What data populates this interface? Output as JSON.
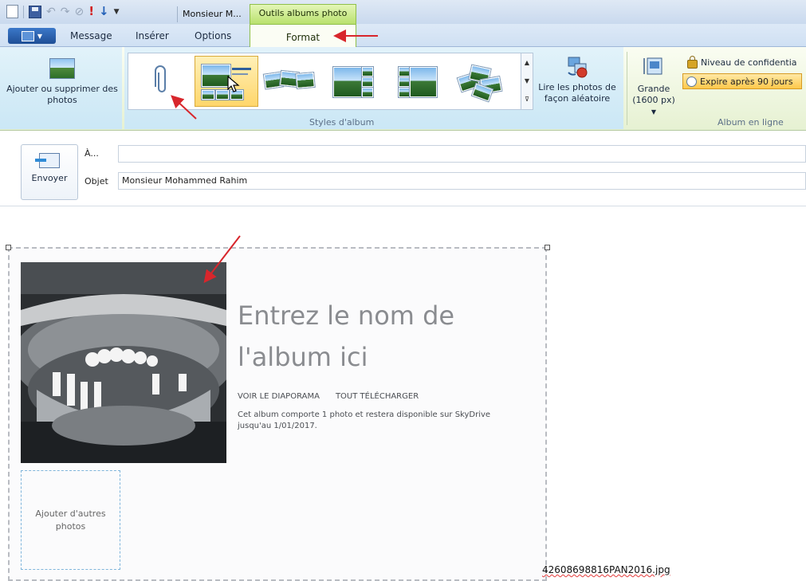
{
  "window": {
    "document_title": "Monsieur M...",
    "contextual_tab_group": "Outils albums photo"
  },
  "tabs": {
    "file_menu_icon": "menu-icon",
    "items": [
      "Message",
      "Insérer",
      "Options"
    ],
    "active": "Format"
  },
  "ribbon": {
    "add_photos_label": "Ajouter ou supprimer des photos",
    "album_styles_label": "Styles d'album",
    "shuffle_label": "Lire les photos de façon aléatoire",
    "size_label_line1": "Grande",
    "size_label_line2": "(1600 px)",
    "online_album_label": "Album en ligne",
    "privacy_label": "Niveau de confidentia",
    "expire_label": "Expire après 90 jours",
    "gallery_styles": [
      "attachment",
      "single-with-thumbnails",
      "photo-strip",
      "mosaic",
      "grid",
      "collage"
    ],
    "gallery_selected_index": 1
  },
  "compose": {
    "send_label": "Envoyer",
    "to_label": "À...",
    "to_value": "",
    "subject_label": "Objet",
    "subject_value": "Monsieur Mohammed Rahim"
  },
  "album": {
    "title": "Entrez le nom de l'album ici",
    "slideshow_link": "VOIR LE DIAPORAMA",
    "download_link": "TOUT TÉLÉCHARGER",
    "info": "Cet album comporte 1 photo et restera disponible sur SkyDrive jusqu'au 1/01/2017.",
    "add_more_label": "Ajouter d'autres photos",
    "filename": "42608698816PAN2016.jpg"
  },
  "colors": {
    "accent_arrow": "#d8262c",
    "contextual_green": "#b7e06a",
    "title_gray": "#8a8c90"
  }
}
